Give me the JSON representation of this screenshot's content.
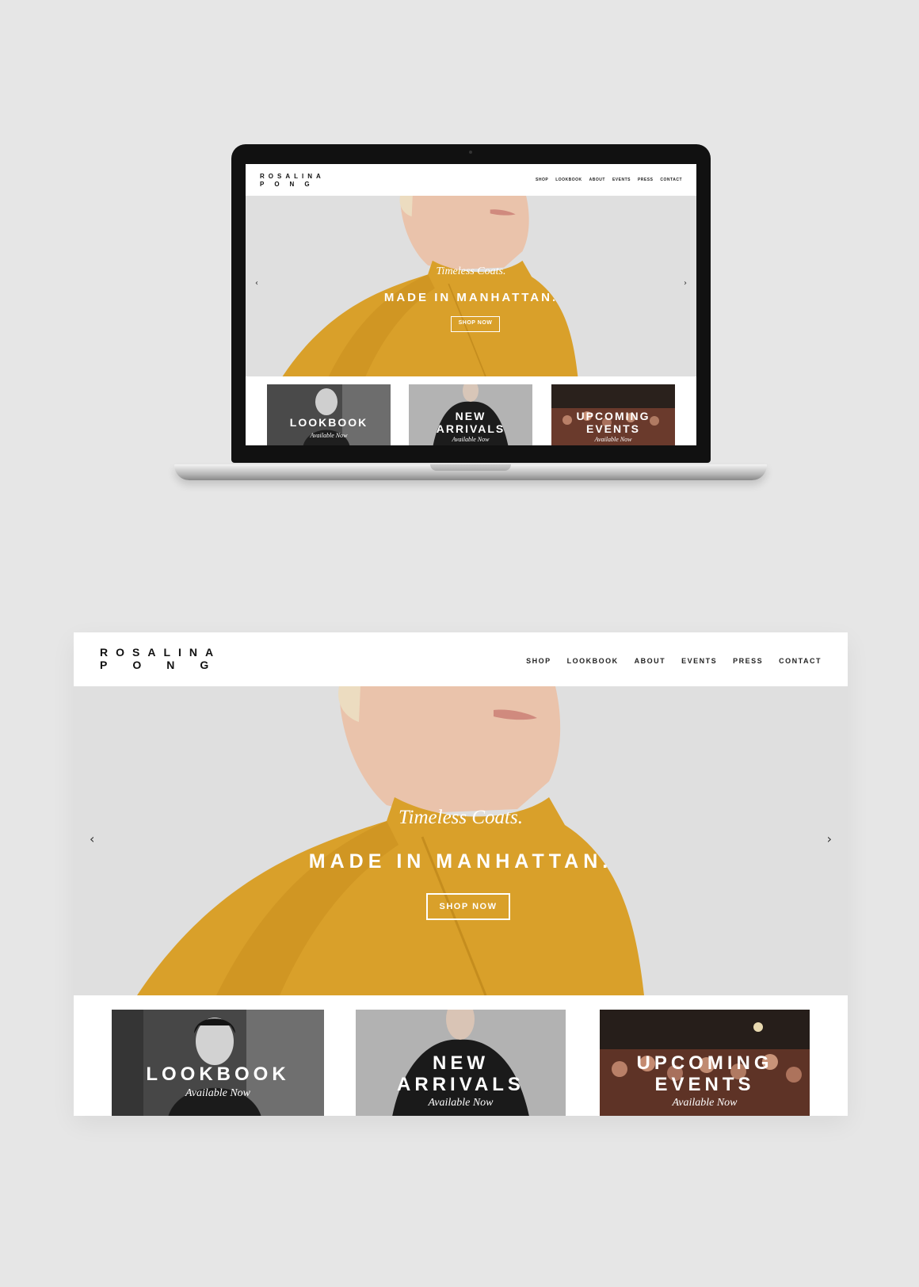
{
  "brand": {
    "logo_line1": "ROSALINA",
    "logo_line2": "PONG"
  },
  "nav": [
    "SHOP",
    "LOOKBOOK",
    "ABOUT",
    "EVENTS",
    "PRESS",
    "CONTACT"
  ],
  "hero": {
    "tagline": "Timeless Coats.",
    "headline": "MADE IN MANHATTAN.",
    "cta": "SHOP NOW",
    "prev_arrow": "‹",
    "next_arrow": "›"
  },
  "tiles": [
    {
      "title_line1": "LOOKBOOK",
      "title_line2": "",
      "subtitle": "Available Now"
    },
    {
      "title_line1": "NEW",
      "title_line2": "ARRIVALS",
      "subtitle": "Available Now"
    },
    {
      "title_line1": "UPCOMING",
      "title_line2": "EVENTS",
      "subtitle": "Available Now"
    }
  ],
  "colors": {
    "background": "#e6e6e6",
    "coat": "#d9a02a",
    "hero_bg": "#dfdfdf",
    "text_dark": "#111111"
  }
}
